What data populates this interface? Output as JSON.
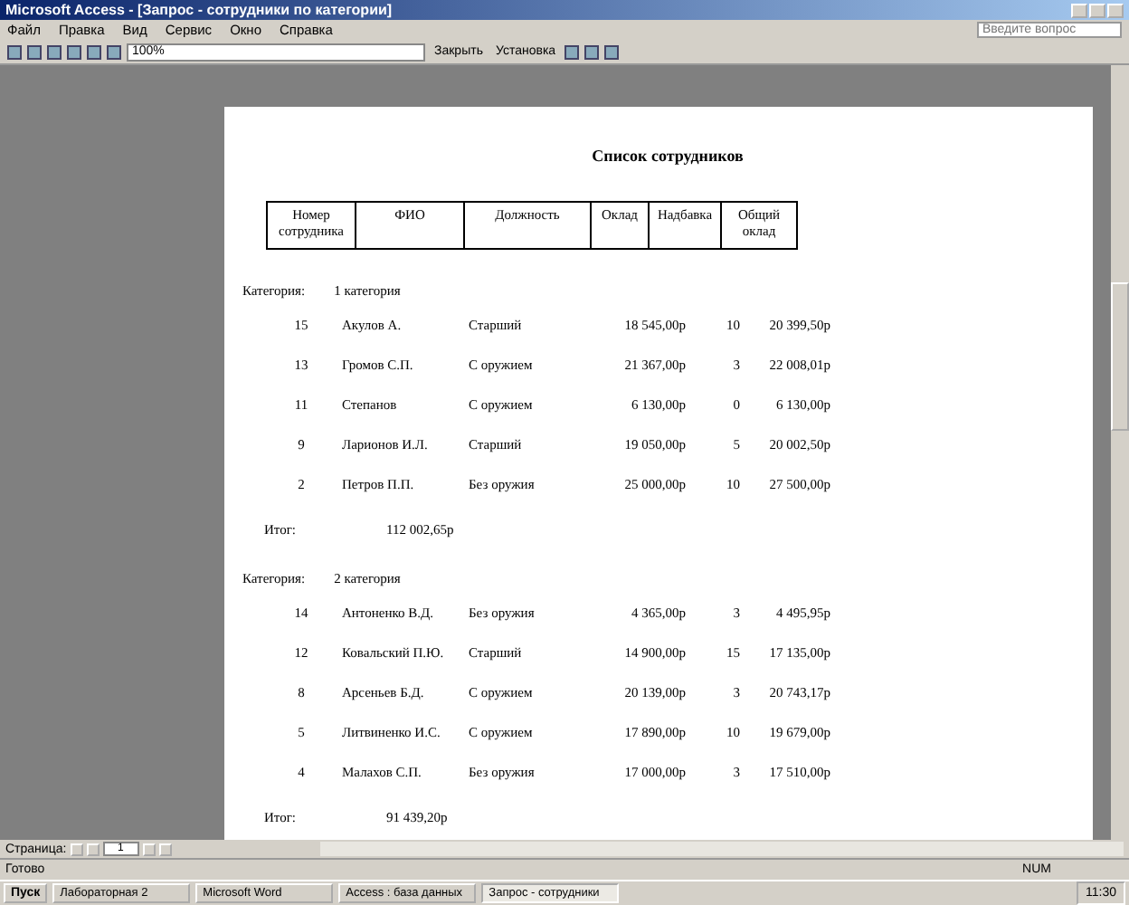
{
  "window": {
    "title": "Microsoft Access - [Запрос - сотрудники по категории]"
  },
  "menu": [
    "Файл",
    "Правка",
    "Вид",
    "Сервис",
    "Окно",
    "Справка"
  ],
  "help_box": {
    "placeholder": "Введите вопрос"
  },
  "toolbar": {
    "zoom": "100%",
    "buttons": [
      "Закрыть",
      "Установка"
    ]
  },
  "report": {
    "title": "Список сотрудников",
    "columns": [
      "Номер сотрудника",
      "ФИО",
      "Должность",
      "Оклад",
      "Надбавка",
      "Общий оклад"
    ],
    "groups": [
      {
        "label": "Категория:",
        "category": "1 категория",
        "total_label": "Итог:",
        "total": "112 002,65р",
        "rows": [
          [
            "15",
            "Акулов А.",
            "Старший",
            "18 545,00р",
            "10",
            "20 399,50р"
          ],
          [
            "13",
            "Громов С.П.",
            "С оружием",
            "21 367,00р",
            "3",
            "22 008,01р"
          ],
          [
            "11",
            "Степанов",
            "С оружием",
            "6 130,00р",
            "0",
            "6 130,00р"
          ],
          [
            "9",
            "Ларионов И.Л.",
            "Старший",
            "19 050,00р",
            "5",
            "20 002,50р"
          ],
          [
            "2",
            "Петров П.П.",
            "Без оружия",
            "25 000,00р",
            "10",
            "27 500,00р"
          ]
        ]
      },
      {
        "label": "Категория:",
        "category": "2 категория",
        "total_label": "Итог:",
        "total": "91 439,20р",
        "rows": [
          [
            "14",
            "Антоненко В.Д.",
            "Без оружия",
            "4 365,00р",
            "3",
            "4 495,95р"
          ],
          [
            "12",
            "Ковальский П.Ю.",
            "Старший",
            "14 900,00р",
            "15",
            "17 135,00р"
          ],
          [
            "8",
            "Арсеньев Б.Д.",
            "С оружием",
            "20 139,00р",
            "3",
            "20 743,17р"
          ],
          [
            "5",
            "Литвиненко И.С.",
            "С оружием",
            "17 890,00р",
            "10",
            "19 679,00р"
          ],
          [
            "4",
            "Малахов С.П.",
            "Без оружия",
            "17 000,00р",
            "3",
            "17 510,00р"
          ]
        ]
      }
    ]
  },
  "pager": {
    "label": "Страница:",
    "page": "1"
  },
  "status_bar": {
    "text": "Готово",
    "num": "NUM"
  },
  "taskbar": {
    "start": "Пуск",
    "tasks": [
      {
        "label": "Лабораторная 2",
        "selected": false
      },
      {
        "label": "Microsoft Word",
        "selected": false
      },
      {
        "label": "Access : база данных",
        "selected": false
      },
      {
        "label": "Запрос - сотрудники",
        "selected": true
      }
    ],
    "clock": "11:30"
  }
}
